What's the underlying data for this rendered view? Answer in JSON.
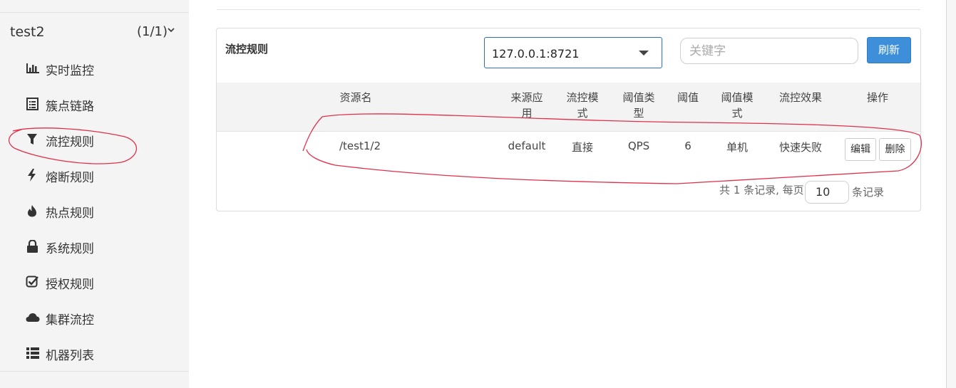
{
  "sidebar": {
    "app": {
      "name": "test2",
      "count": "(1/1)"
    },
    "items": [
      {
        "label": "实时监控",
        "icon": "bar-chart-icon"
      },
      {
        "label": "簇点链路",
        "icon": "list-icon"
      },
      {
        "label": "流控规则",
        "icon": "filter-icon"
      },
      {
        "label": "熔断规则",
        "icon": "bolt-icon"
      },
      {
        "label": "热点规则",
        "icon": "fire-icon"
      },
      {
        "label": "系统规则",
        "icon": "lock-icon"
      },
      {
        "label": "授权规则",
        "icon": "check-square-icon"
      },
      {
        "label": "集群流控",
        "icon": "cloud-icon"
      },
      {
        "label": "机器列表",
        "icon": "th-list-icon"
      }
    ]
  },
  "panel": {
    "title": "流控规则",
    "machine_select": {
      "value": "127.0.0.1:8721"
    },
    "search": {
      "placeholder": "关键字",
      "value": ""
    },
    "refresh_label": "刷新"
  },
  "table": {
    "headers": {
      "resource": "资源名",
      "origin": [
        "来源应",
        "用"
      ],
      "mode": [
        "流控模",
        "式"
      ],
      "threshold_type": [
        "阈值类",
        "型"
      ],
      "threshold": "阈值",
      "threshold_mode": [
        "阈值模",
        "式"
      ],
      "effect": "流控效果",
      "ops": "操作"
    },
    "rows": [
      {
        "resource": "/test1/2",
        "origin": "default",
        "mode": "直接",
        "threshold_type": "QPS",
        "threshold": "6",
        "threshold_mode": "单机",
        "effect": "快速失败",
        "edit_label": "编辑",
        "delete_label": "删除"
      }
    ]
  },
  "pagination": {
    "summary": "共 1 条记录, 每页",
    "page_size": "10",
    "suffix": "条记录"
  },
  "colors": {
    "primary": "#3c8fd8",
    "annotation": "#e0304a",
    "sidebar_bg": "#f4f4f4"
  }
}
